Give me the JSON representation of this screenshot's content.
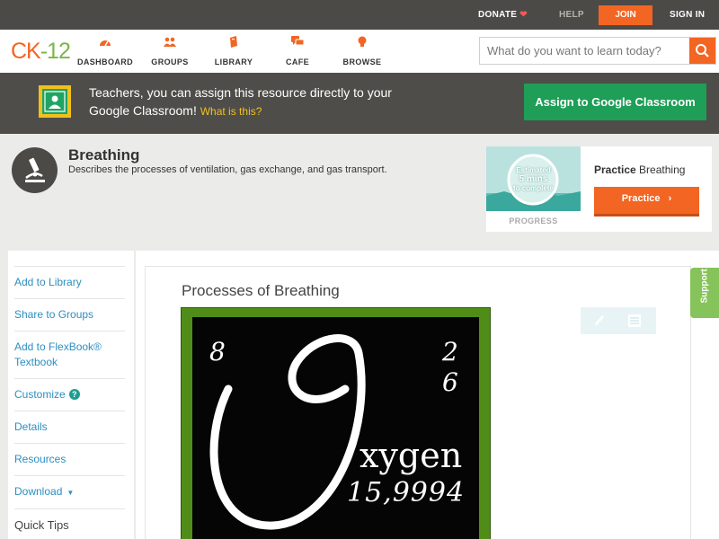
{
  "topbar": {
    "donate": "DONATE",
    "help": "HELP",
    "join": "JOIN",
    "signin": "SIGN IN"
  },
  "logo": {
    "part1": "CK",
    "part2": "-12"
  },
  "nav": {
    "items": [
      {
        "label": "DASHBOARD",
        "icon": "dashboard-icon"
      },
      {
        "label": "GROUPS",
        "icon": "groups-icon"
      },
      {
        "label": "LIBRARY",
        "icon": "library-icon"
      },
      {
        "label": "CAFE",
        "icon": "cafe-icon"
      },
      {
        "label": "BROWSE",
        "icon": "browse-icon"
      }
    ]
  },
  "search": {
    "placeholder": "What do you want to learn today?"
  },
  "classroom": {
    "message": "Teachers, you can assign this resource directly to your Google Classroom!",
    "what_link": "What is this?",
    "button": "Assign to Google Classroom"
  },
  "concept": {
    "title": "Breathing",
    "description": "Describes the processes of ventilation, gas exchange, and gas transport."
  },
  "progress": {
    "estimate_line1": "Estimated",
    "estimate_line2": "5 mins",
    "estimate_line3": "to complete",
    "label": "PROGRESS",
    "practice_prefix": "Practice",
    "practice_topic": "Breathing",
    "practice_button": "Practice"
  },
  "sidebar": {
    "items": [
      {
        "label": "Add to Library"
      },
      {
        "label": "Share to Groups"
      },
      {
        "label": "Add to FlexBook® Textbook"
      },
      {
        "label": "Customize"
      },
      {
        "label": "Details"
      },
      {
        "label": "Resources"
      },
      {
        "label": "Download"
      }
    ],
    "quick_tips": "Quick Tips"
  },
  "main": {
    "title": "Processes of Breathing",
    "image": {
      "atomic_number": "8",
      "shell1": "2",
      "shell2": "6",
      "element_rest": "xygen",
      "atomic_mass": "15,9994"
    }
  },
  "support": "Support",
  "colors": {
    "accent": "#f26522",
    "green": "#1e9e57",
    "link": "#2d8ec1",
    "dark_bar": "#4b4a47"
  }
}
